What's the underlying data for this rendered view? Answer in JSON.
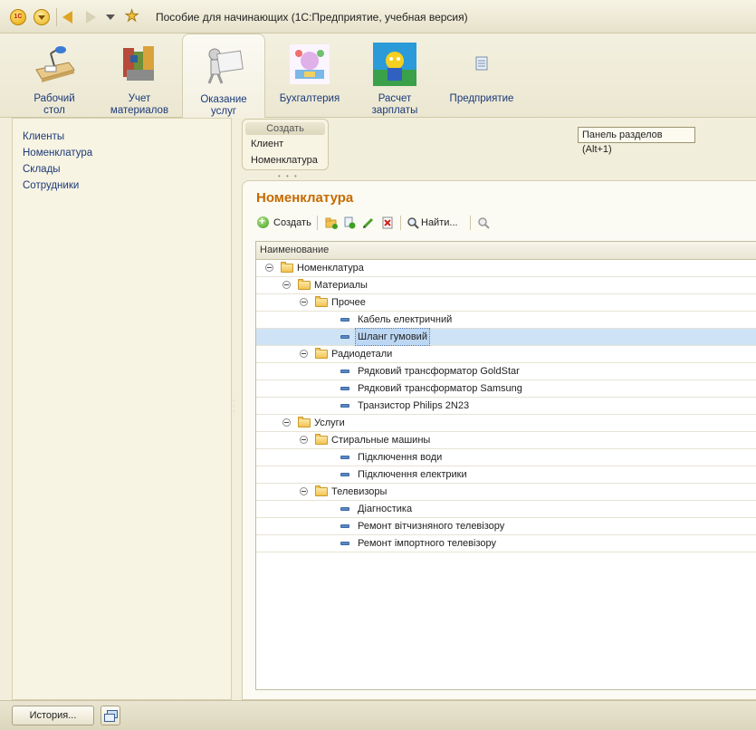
{
  "window": {
    "title": "Пособие для начинающих  (1С:Предприятие, учебная версия)",
    "logo_text": "1С"
  },
  "sections": [
    {
      "label": "Рабочий стол",
      "icon": "desk-lamp-icon"
    },
    {
      "label": "Учет материалов",
      "icon": "materials-icon"
    },
    {
      "label": "Оказание услуг",
      "icon": "services-icon"
    },
    {
      "label": "Бухгалтерия",
      "icon": "accounting-icon"
    },
    {
      "label": "Расчет зарплаты",
      "icon": "salary-icon"
    },
    {
      "label": "Предприятие",
      "icon": "enterprise-icon"
    }
  ],
  "sidebar": {
    "items": [
      "Клиенты",
      "Номенклатура",
      "Склады",
      "Сотрудники"
    ]
  },
  "create_panel": {
    "header": "Создать",
    "items": [
      "Клиент",
      "Номенклатура"
    ]
  },
  "tooltip": "Панель разделов (Alt+1)",
  "form": {
    "title": "Номенклатура",
    "toolbar": {
      "create_label": "Создать",
      "find_label": "Найти..."
    },
    "table": {
      "column_header": "Наименование",
      "rows": [
        {
          "level": 0,
          "type": "folder",
          "text": "Номенклатура"
        },
        {
          "level": 1,
          "type": "folder",
          "text": "Материалы"
        },
        {
          "level": 2,
          "type": "folder",
          "text": "Прочее"
        },
        {
          "level": 3,
          "type": "item",
          "text": "Кабель електричний"
        },
        {
          "level": 3,
          "type": "item",
          "text": "Шланг гумовий",
          "selected": true
        },
        {
          "level": 2,
          "type": "folder",
          "text": "Радиодетали"
        },
        {
          "level": 3,
          "type": "item",
          "text": "Рядковий трансформатор GoldStar"
        },
        {
          "level": 3,
          "type": "item",
          "text": "Рядковий трансформатор Samsung"
        },
        {
          "level": 3,
          "type": "item",
          "text": "Транзистор Philips 2N23"
        },
        {
          "level": 1,
          "type": "folder",
          "text": "Услуги"
        },
        {
          "level": 2,
          "type": "folder",
          "text": "Стиральные машины"
        },
        {
          "level": 3,
          "type": "item",
          "text": "Підключення води"
        },
        {
          "level": 3,
          "type": "item",
          "text": "Підключення електрики"
        },
        {
          "level": 2,
          "type": "folder",
          "text": "Телевизоры"
        },
        {
          "level": 3,
          "type": "item",
          "text": "Діагностика"
        },
        {
          "level": 3,
          "type": "item",
          "text": "Ремонт вітчизняного телевізору"
        },
        {
          "level": 3,
          "type": "item",
          "text": "Ремонт імпортного телевізору"
        }
      ]
    }
  },
  "bottom": {
    "history_label": "История..."
  },
  "colors": {
    "accent_title": "#c66a00",
    "link": "#1c3a79",
    "selection": "#cfe3f7"
  }
}
